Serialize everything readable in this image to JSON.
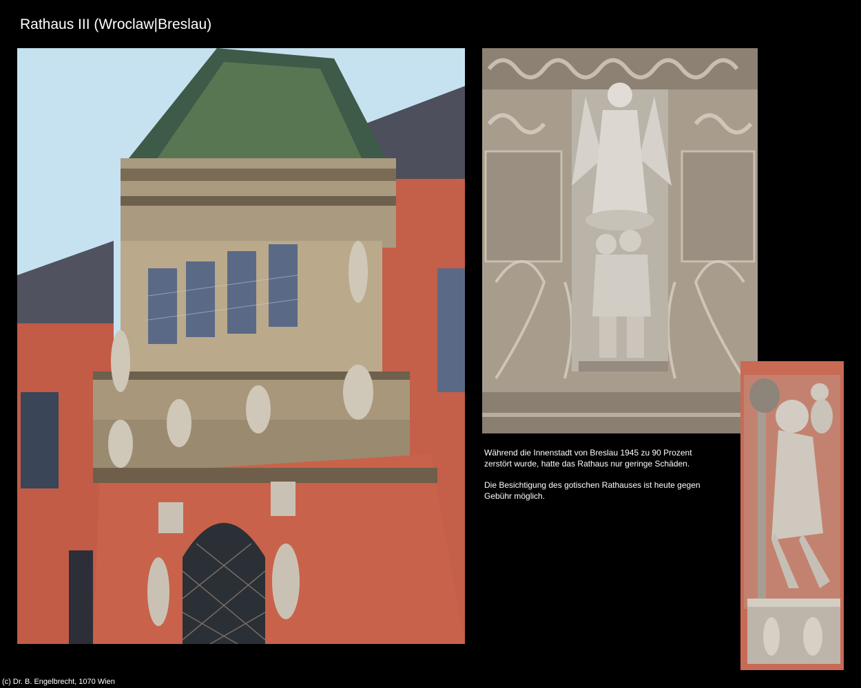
{
  "page": {
    "title": "Rathaus III (Wroclaw|Breslau)",
    "footer": "(c) Dr. B. Engelbrecht, 1070 Wien"
  },
  "caption": {
    "paragraph1": "Während die Innenstadt von Breslau 1945 zu 90 Prozent zerstört wurde, hatte das Rathaus nur geringe Schäden.",
    "paragraph2": "Die Besichtigung des gotischen Rathauses ist heute gegen Gebühr möglich."
  },
  "colors": {
    "background": "#000000",
    "sky": "#bfe0f0",
    "brick": "#c8604a",
    "stone": "#b9a98e",
    "roof": "#4d4f5c",
    "sculpture": "#c9c6c0"
  }
}
